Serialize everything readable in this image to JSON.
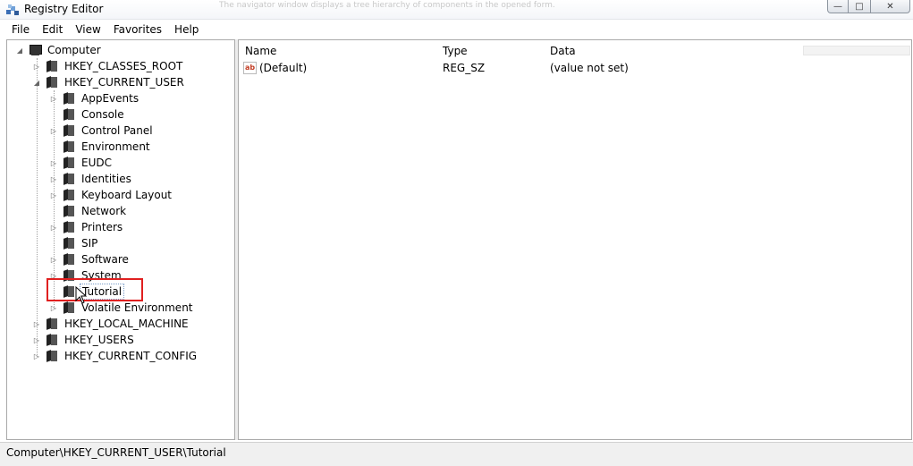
{
  "window": {
    "title": "Registry Editor",
    "faded_notification": "The navigator window displays a tree hierarchy of components in the opened form."
  },
  "menu": [
    "File",
    "Edit",
    "View",
    "Favorites",
    "Help"
  ],
  "tree": {
    "root": "Computer",
    "hives": {
      "classes_root": "HKEY_CLASSES_ROOT",
      "current_user": "HKEY_CURRENT_USER",
      "local_machine": "HKEY_LOCAL_MACHINE",
      "users": "HKEY_USERS",
      "current_config": "HKEY_CURRENT_CONFIG"
    },
    "current_user_children": [
      "AppEvents",
      "Console",
      "Control Panel",
      "Environment",
      "EUDC",
      "Identities",
      "Keyboard Layout",
      "Network",
      "Printers",
      "SIP",
      "Software",
      "System",
      "Tutorial",
      "Volatile Environment"
    ],
    "selected": "Tutorial"
  },
  "list": {
    "columns": {
      "name": "Name",
      "type": "Type",
      "data": "Data"
    },
    "rows": [
      {
        "name": "(Default)",
        "type": "REG_SZ",
        "data": "(value not set)",
        "icon": "string-value-icon"
      }
    ]
  },
  "status": {
    "path": "Computer\\HKEY_CURRENT_USER\\Tutorial"
  },
  "colors": {
    "highlight": "#e02020"
  }
}
